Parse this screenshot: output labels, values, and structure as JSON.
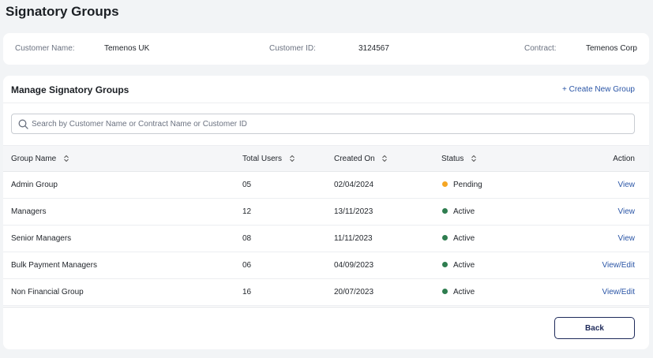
{
  "page": {
    "title": "Signatory Groups"
  },
  "customer_info": {
    "name_label": "Customer Name:",
    "name_value": "Temenos UK",
    "id_label": "Customer ID:",
    "id_value": "3124567",
    "contract_label": "Contract:",
    "contract_value": "Temenos Corp"
  },
  "manage": {
    "title": "Manage Signatory Groups",
    "create_link": "+ Create New Group",
    "search_placeholder": "Search by Customer Name or Contract Name or Customer ID",
    "search_value": ""
  },
  "table": {
    "headers": {
      "group_name": "Group Name",
      "total_users": "Total Users",
      "created_on": "Created On",
      "status": "Status",
      "action": "Action"
    },
    "rows": [
      {
        "group_name": "Admin Group",
        "total_users": "05",
        "created_on": "02/04/2024",
        "status": "Pending",
        "status_color": "#f5a623",
        "action": "View"
      },
      {
        "group_name": "Managers",
        "total_users": "12",
        "created_on": "13/11/2023",
        "status": "Active",
        "status_color": "#2e7d4f",
        "action": "View"
      },
      {
        "group_name": "Senior Managers",
        "total_users": "08",
        "created_on": "11/11/2023",
        "status": "Active",
        "status_color": "#2e7d4f",
        "action": "View"
      },
      {
        "group_name": "Bulk Payment Managers",
        "total_users": "06",
        "created_on": "04/09/2023",
        "status": "Active",
        "status_color": "#2e7d4f",
        "action": "View/Edit"
      },
      {
        "group_name": "Non Financial Group",
        "total_users": "16",
        "created_on": "20/07/2023",
        "status": "Active",
        "status_color": "#2e7d4f",
        "action": "View/Edit"
      }
    ]
  },
  "footer": {
    "back_label": "Back"
  },
  "colors": {
    "accent_link": "#2a55a6",
    "primary_dark": "#1e2a5a",
    "pending": "#f5a623",
    "active": "#2e7d4f"
  }
}
